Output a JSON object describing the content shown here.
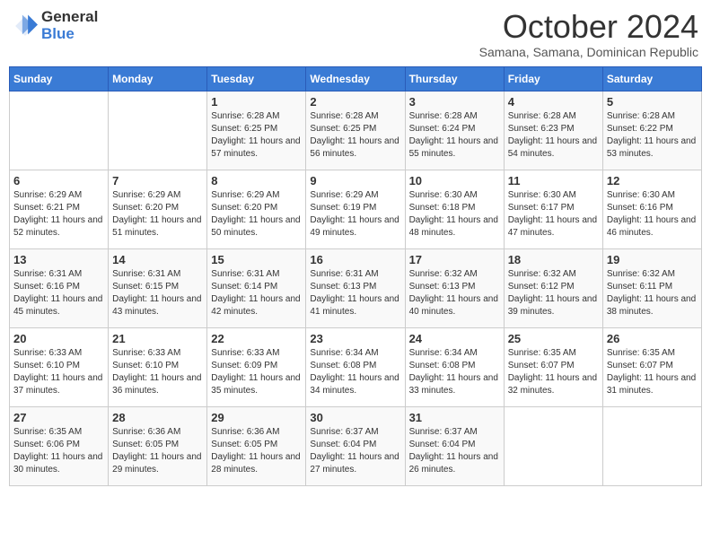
{
  "logo": {
    "general": "General",
    "blue": "Blue"
  },
  "title": "October 2024",
  "location": "Samana, Samana, Dominican Republic",
  "days_of_week": [
    "Sunday",
    "Monday",
    "Tuesday",
    "Wednesday",
    "Thursday",
    "Friday",
    "Saturday"
  ],
  "weeks": [
    [
      {
        "day": "",
        "sunrise": "",
        "sunset": "",
        "daylight": ""
      },
      {
        "day": "",
        "sunrise": "",
        "sunset": "",
        "daylight": ""
      },
      {
        "day": "1",
        "sunrise": "Sunrise: 6:28 AM",
        "sunset": "Sunset: 6:25 PM",
        "daylight": "Daylight: 11 hours and 57 minutes."
      },
      {
        "day": "2",
        "sunrise": "Sunrise: 6:28 AM",
        "sunset": "Sunset: 6:25 PM",
        "daylight": "Daylight: 11 hours and 56 minutes."
      },
      {
        "day": "3",
        "sunrise": "Sunrise: 6:28 AM",
        "sunset": "Sunset: 6:24 PM",
        "daylight": "Daylight: 11 hours and 55 minutes."
      },
      {
        "day": "4",
        "sunrise": "Sunrise: 6:28 AM",
        "sunset": "Sunset: 6:23 PM",
        "daylight": "Daylight: 11 hours and 54 minutes."
      },
      {
        "day": "5",
        "sunrise": "Sunrise: 6:28 AM",
        "sunset": "Sunset: 6:22 PM",
        "daylight": "Daylight: 11 hours and 53 minutes."
      }
    ],
    [
      {
        "day": "6",
        "sunrise": "Sunrise: 6:29 AM",
        "sunset": "Sunset: 6:21 PM",
        "daylight": "Daylight: 11 hours and 52 minutes."
      },
      {
        "day": "7",
        "sunrise": "Sunrise: 6:29 AM",
        "sunset": "Sunset: 6:20 PM",
        "daylight": "Daylight: 11 hours and 51 minutes."
      },
      {
        "day": "8",
        "sunrise": "Sunrise: 6:29 AM",
        "sunset": "Sunset: 6:20 PM",
        "daylight": "Daylight: 11 hours and 50 minutes."
      },
      {
        "day": "9",
        "sunrise": "Sunrise: 6:29 AM",
        "sunset": "Sunset: 6:19 PM",
        "daylight": "Daylight: 11 hours and 49 minutes."
      },
      {
        "day": "10",
        "sunrise": "Sunrise: 6:30 AM",
        "sunset": "Sunset: 6:18 PM",
        "daylight": "Daylight: 11 hours and 48 minutes."
      },
      {
        "day": "11",
        "sunrise": "Sunrise: 6:30 AM",
        "sunset": "Sunset: 6:17 PM",
        "daylight": "Daylight: 11 hours and 47 minutes."
      },
      {
        "day": "12",
        "sunrise": "Sunrise: 6:30 AM",
        "sunset": "Sunset: 6:16 PM",
        "daylight": "Daylight: 11 hours and 46 minutes."
      }
    ],
    [
      {
        "day": "13",
        "sunrise": "Sunrise: 6:31 AM",
        "sunset": "Sunset: 6:16 PM",
        "daylight": "Daylight: 11 hours and 45 minutes."
      },
      {
        "day": "14",
        "sunrise": "Sunrise: 6:31 AM",
        "sunset": "Sunset: 6:15 PM",
        "daylight": "Daylight: 11 hours and 43 minutes."
      },
      {
        "day": "15",
        "sunrise": "Sunrise: 6:31 AM",
        "sunset": "Sunset: 6:14 PM",
        "daylight": "Daylight: 11 hours and 42 minutes."
      },
      {
        "day": "16",
        "sunrise": "Sunrise: 6:31 AM",
        "sunset": "Sunset: 6:13 PM",
        "daylight": "Daylight: 11 hours and 41 minutes."
      },
      {
        "day": "17",
        "sunrise": "Sunrise: 6:32 AM",
        "sunset": "Sunset: 6:13 PM",
        "daylight": "Daylight: 11 hours and 40 minutes."
      },
      {
        "day": "18",
        "sunrise": "Sunrise: 6:32 AM",
        "sunset": "Sunset: 6:12 PM",
        "daylight": "Daylight: 11 hours and 39 minutes."
      },
      {
        "day": "19",
        "sunrise": "Sunrise: 6:32 AM",
        "sunset": "Sunset: 6:11 PM",
        "daylight": "Daylight: 11 hours and 38 minutes."
      }
    ],
    [
      {
        "day": "20",
        "sunrise": "Sunrise: 6:33 AM",
        "sunset": "Sunset: 6:10 PM",
        "daylight": "Daylight: 11 hours and 37 minutes."
      },
      {
        "day": "21",
        "sunrise": "Sunrise: 6:33 AM",
        "sunset": "Sunset: 6:10 PM",
        "daylight": "Daylight: 11 hours and 36 minutes."
      },
      {
        "day": "22",
        "sunrise": "Sunrise: 6:33 AM",
        "sunset": "Sunset: 6:09 PM",
        "daylight": "Daylight: 11 hours and 35 minutes."
      },
      {
        "day": "23",
        "sunrise": "Sunrise: 6:34 AM",
        "sunset": "Sunset: 6:08 PM",
        "daylight": "Daylight: 11 hours and 34 minutes."
      },
      {
        "day": "24",
        "sunrise": "Sunrise: 6:34 AM",
        "sunset": "Sunset: 6:08 PM",
        "daylight": "Daylight: 11 hours and 33 minutes."
      },
      {
        "day": "25",
        "sunrise": "Sunrise: 6:35 AM",
        "sunset": "Sunset: 6:07 PM",
        "daylight": "Daylight: 11 hours and 32 minutes."
      },
      {
        "day": "26",
        "sunrise": "Sunrise: 6:35 AM",
        "sunset": "Sunset: 6:07 PM",
        "daylight": "Daylight: 11 hours and 31 minutes."
      }
    ],
    [
      {
        "day": "27",
        "sunrise": "Sunrise: 6:35 AM",
        "sunset": "Sunset: 6:06 PM",
        "daylight": "Daylight: 11 hours and 30 minutes."
      },
      {
        "day": "28",
        "sunrise": "Sunrise: 6:36 AM",
        "sunset": "Sunset: 6:05 PM",
        "daylight": "Daylight: 11 hours and 29 minutes."
      },
      {
        "day": "29",
        "sunrise": "Sunrise: 6:36 AM",
        "sunset": "Sunset: 6:05 PM",
        "daylight": "Daylight: 11 hours and 28 minutes."
      },
      {
        "day": "30",
        "sunrise": "Sunrise: 6:37 AM",
        "sunset": "Sunset: 6:04 PM",
        "daylight": "Daylight: 11 hours and 27 minutes."
      },
      {
        "day": "31",
        "sunrise": "Sunrise: 6:37 AM",
        "sunset": "Sunset: 6:04 PM",
        "daylight": "Daylight: 11 hours and 26 minutes."
      },
      {
        "day": "",
        "sunrise": "",
        "sunset": "",
        "daylight": ""
      },
      {
        "day": "",
        "sunrise": "",
        "sunset": "",
        "daylight": ""
      }
    ]
  ]
}
